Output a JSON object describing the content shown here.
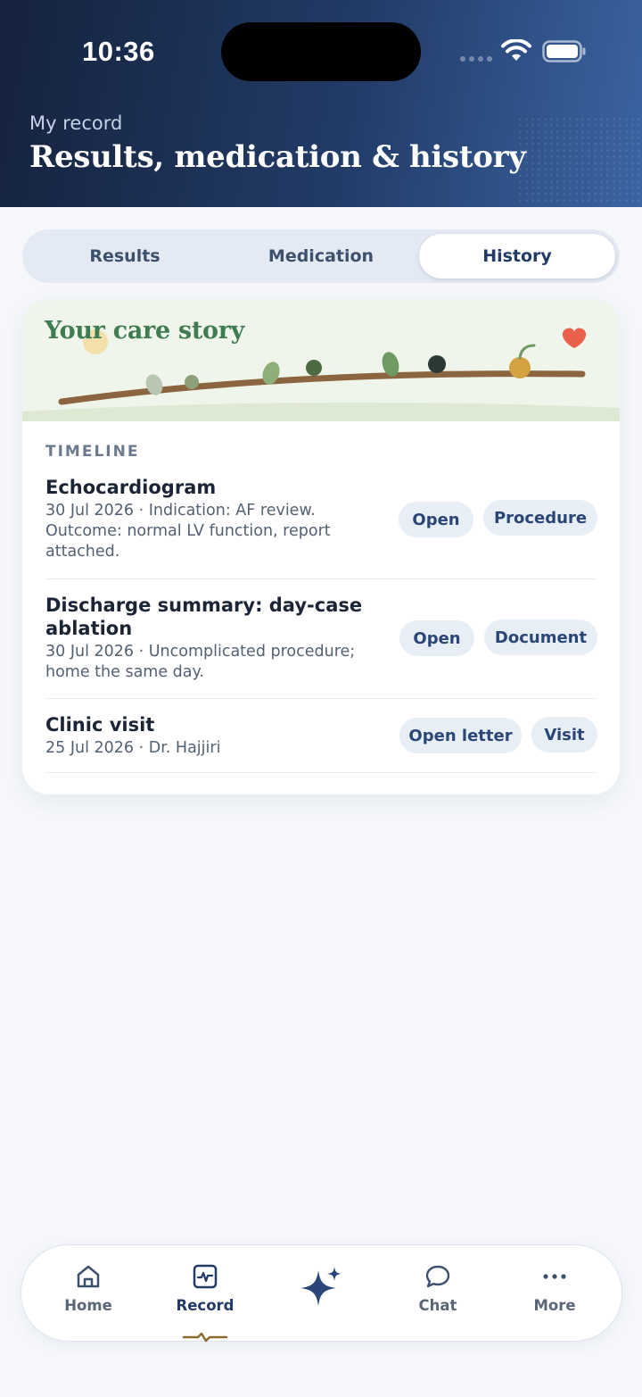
{
  "status_bar": {
    "time": "10:36"
  },
  "header": {
    "kicker": "My record",
    "title": "Results, medication & history"
  },
  "tabs": [
    {
      "label": "Results",
      "active": false
    },
    {
      "label": "Medication",
      "active": false
    },
    {
      "label": "History",
      "active": true
    }
  ],
  "care_story": {
    "title": "Your care story"
  },
  "timeline": {
    "label": "TIMELINE",
    "entries": [
      {
        "title": "Echocardiogram",
        "meta": "30 Jul 2026 · Indication: AF review. Outcome: normal LV function, report attached.",
        "action": "Open",
        "type": "Procedure"
      },
      {
        "title": "Discharge summary: day-case ablation",
        "meta": "30 Jul 2026 · Uncomplicated procedure; home the same day.",
        "action": "Open",
        "type": "Document"
      },
      {
        "title": "Clinic visit",
        "meta": "25 Jul 2026 · Dr. Hajjiri",
        "action": "Open letter",
        "type": "Visit"
      }
    ]
  },
  "bottom_nav": {
    "items": [
      {
        "label": "Home",
        "icon": "home-icon",
        "active": false
      },
      {
        "label": "Record",
        "icon": "record-icon",
        "active": true
      },
      {
        "label": "",
        "icon": "sparkle-icon",
        "active": false
      },
      {
        "label": "Chat",
        "icon": "chat-bubble-icon",
        "active": false
      },
      {
        "label": "More",
        "icon": "more-dots-icon",
        "active": false
      }
    ]
  },
  "colors": {
    "header_start": "#15223d",
    "header_end": "#3b64a3",
    "accent": "#223a66",
    "story_title": "#3f7c52",
    "heart": "#e8604a",
    "nav_underline": "#8a6b2f"
  }
}
